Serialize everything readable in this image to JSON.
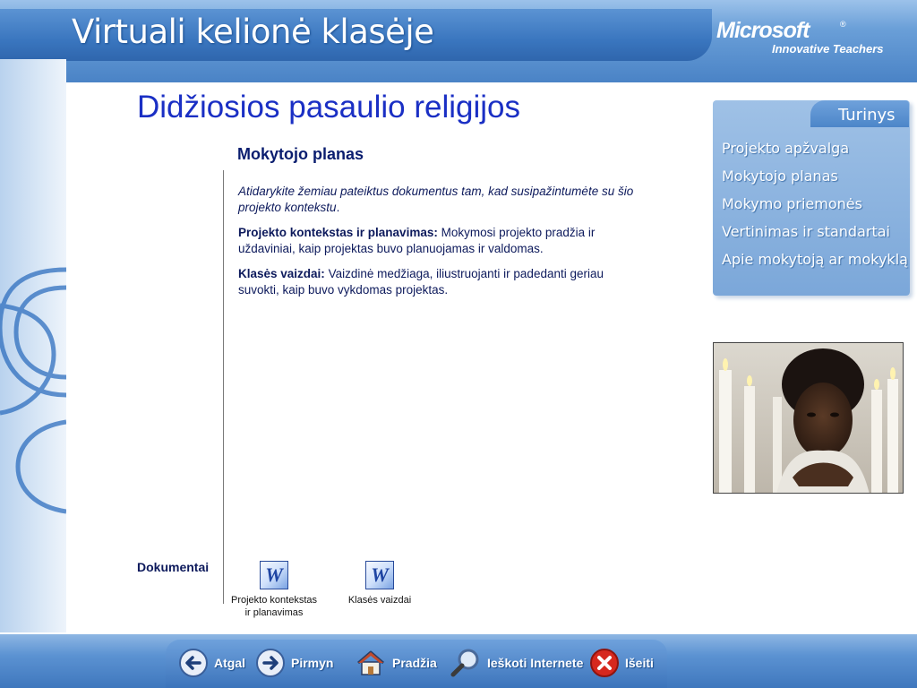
{
  "header": {
    "app_title": "Virtuali kelionė klasėje",
    "brand": "Microsoft",
    "brand_mark": "®",
    "brand_sub": "Innovative Teachers"
  },
  "page": {
    "title": "Didžiosios pasaulio religijos",
    "subheading": "Mokytojo planas"
  },
  "content": {
    "intro": "Atidarykite žemiau pateiktus dokumentus tam, kad susipažintumėte su šio projekto kontekstu",
    "intro_end": ".",
    "item1_title": "Projekto kontekstas ir planavimas:",
    "item1_text": " Mokymosi projekto pradžia ir uždaviniai, kaip projektas buvo planuojamas ir valdomas.",
    "item2_title": "Klasės vaizdai:",
    "item2_text": " Vaizdinė medžiaga, iliustruojanti ir padedanti geriau suvokti, kaip buvo vykdomas projektas."
  },
  "documents": {
    "label": "Dokumentai",
    "items": [
      {
        "label_line1": "Projekto kontekstas",
        "label_line2": "ir planavimas",
        "icon": "word-doc-icon"
      },
      {
        "label_line1": "Klasės vaizdai",
        "label_line2": "",
        "icon": "word-doc-icon"
      }
    ]
  },
  "sidebar": {
    "tab_label": "Turinys",
    "items": [
      {
        "label": "Projekto apžvalga"
      },
      {
        "label": "Mokytojo planas"
      },
      {
        "label": "Mokymo priemonės"
      },
      {
        "label": "Vertinimas ir standartai"
      },
      {
        "label": "Apie mokytoją ar mokyklą"
      }
    ]
  },
  "bottom_nav": {
    "back": "Atgal",
    "forward": "Pirmyn",
    "home": "Pradžia",
    "search": "Ieškoti Internete",
    "exit": "Išeiti"
  },
  "colors": {
    "title": "#1a2fc4",
    "text": "#0d1a5c",
    "header_blue": "#3a76bf",
    "nav_panel": "#7ba7d9"
  }
}
